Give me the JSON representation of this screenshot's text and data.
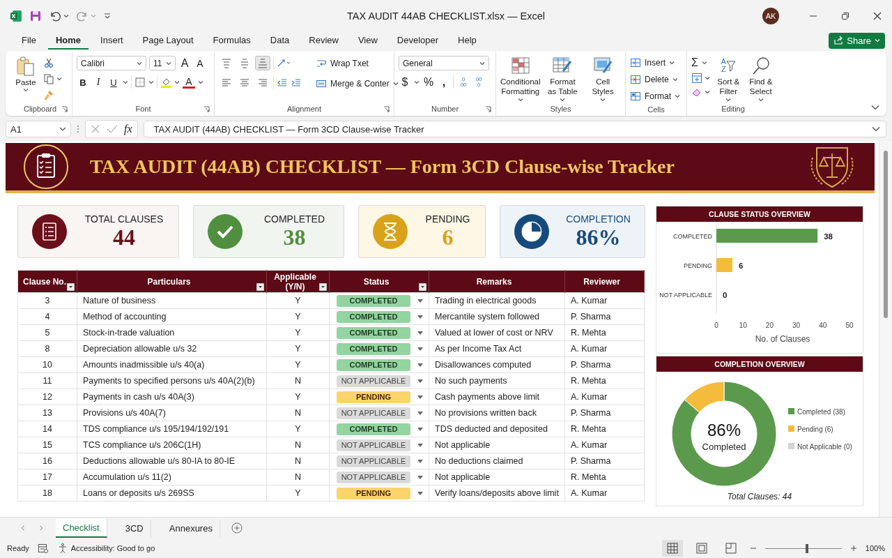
{
  "titlebar": {
    "title": "TAX AUDIT 44AB CHECKLIST.xlsx — Excel",
    "avatar": "AK"
  },
  "menu": [
    {
      "label": "File",
      "selected": false
    },
    {
      "label": "Home",
      "selected": true
    },
    {
      "label": "Insert",
      "selected": false
    },
    {
      "label": "Page Layout",
      "selected": false
    },
    {
      "label": "Formulas",
      "selected": false
    },
    {
      "label": "Data",
      "selected": false
    },
    {
      "label": "Review",
      "selected": false
    },
    {
      "label": "View",
      "selected": false
    },
    {
      "label": "Developer",
      "selected": false
    },
    {
      "label": "Help",
      "selected": false
    }
  ],
  "share": "Share",
  "ribbon": {
    "clipboard": {
      "paste": "Paste",
      "label": "Clipboard"
    },
    "font": {
      "name": "Calibri",
      "size": "11",
      "grow": "A",
      "shrink": "A",
      "bold": "B",
      "italic": "I",
      "underline": "U",
      "font_color_letter": "A",
      "label": "Font"
    },
    "alignment": {
      "vertical": [
        {
          "kind": "top",
          "selected": false
        },
        {
          "kind": "middle",
          "selected": false
        },
        {
          "kind": "bottom",
          "selected": true
        }
      ],
      "horizontal": [
        {
          "kind": "left",
          "selected": false
        },
        {
          "kind": "center",
          "selected": false
        },
        {
          "kind": "right",
          "selected": false
        }
      ],
      "wrap": "Wrap Txet",
      "merge": "Merge & Conter",
      "label": "Alignment"
    },
    "number": {
      "format": "General",
      "currency": "$",
      "percent": "%",
      "comma": ",",
      "decimals": [
        {
          "top": ".0",
          "bottom": ".00"
        },
        {
          "top": ".00",
          "bottom": ".0"
        }
      ],
      "label": "Number"
    },
    "styles": {
      "buttons": [
        {
          "label": "Conditional Formatting",
          "kind": "conditional"
        },
        {
          "label": "Format as Table",
          "kind": "table"
        },
        {
          "label": "Cell Styles",
          "kind": "cell"
        }
      ],
      "label": "Styles"
    },
    "cells": {
      "buttons": [
        {
          "label": "Insert",
          "kind": "insert"
        },
        {
          "label": "Delete",
          "kind": "delete"
        },
        {
          "label": "Format",
          "kind": "format"
        }
      ],
      "label": "Cells"
    },
    "editing": {
      "sum": "Σ",
      "sort_letters": [
        "A",
        "Z"
      ],
      "sort": "Sort & Filter",
      "find": "Find & Select",
      "label": "Editing"
    }
  },
  "formula_bar": {
    "cell": "A1",
    "fx": "fx",
    "formula": "TAX AUDIT (44AB) CHECKLIST — Form 3CD Clause-wise Tracker"
  },
  "banner": {
    "title": "TAX AUDIT (44AB) CHECKLIST — Form 3CD Clause-wise Tracker"
  },
  "kpis": [
    {
      "label": "TOTAL CLAUSES",
      "value": "44",
      "kind": "total"
    },
    {
      "label": "COMPLETED",
      "value": "38",
      "kind": "completed"
    },
    {
      "label": "PENDING",
      "value": "6",
      "kind": "pending"
    },
    {
      "label": "COMPLETION",
      "value": "86%",
      "kind": "completion"
    }
  ],
  "table": {
    "columns": [
      {
        "label": "Clause No.",
        "filter": true
      },
      {
        "label": "Particulars",
        "filter": true
      },
      {
        "label": "Applicable (Y/N)",
        "filter": true
      },
      {
        "label": "Status",
        "filter": true
      },
      {
        "label": "Remarks",
        "filter": false
      },
      {
        "label": "Reviewer",
        "filter": false
      }
    ],
    "rows": [
      {
        "clause": "3",
        "particulars": "Nature of business",
        "applicable": "Y",
        "status": {
          "label": "COMPLETED",
          "kind": "completed"
        },
        "remarks": "Trading in electrical goods",
        "reviewer": "A. Kumar"
      },
      {
        "clause": "4",
        "particulars": "Method of accounting",
        "applicable": "Y",
        "status": {
          "label": "COMPLETED",
          "kind": "completed"
        },
        "remarks": "Mercantile system followed",
        "reviewer": "P. Sharma"
      },
      {
        "clause": "5",
        "particulars": "Stock-in-trade valuation",
        "applicable": "Y",
        "status": {
          "label": "COMPLETED",
          "kind": "completed"
        },
        "remarks": "Valued at lower of cost or NRV",
        "reviewer": "R. Mehta"
      },
      {
        "clause": "8",
        "particulars": "Depreciation allowable u/s 32",
        "applicable": "Y",
        "status": {
          "label": "COMPLETED",
          "kind": "completed"
        },
        "remarks": "As per Income Tax Act",
        "reviewer": "A. Kumar"
      },
      {
        "clause": "10",
        "particulars": "Amounts inadmissible u/s 40(a)",
        "applicable": "Y",
        "status": {
          "label": "COMPLETED",
          "kind": "completed"
        },
        "remarks": "Disallowances computed",
        "reviewer": "P. Sharma"
      },
      {
        "clause": "11",
        "particulars": "Payments to specified persons u/s 40A(2)(b)",
        "applicable": "N",
        "status": {
          "label": "NOT APPLICABLE",
          "kind": "na"
        },
        "remarks": "No such payments",
        "reviewer": "R. Mehta"
      },
      {
        "clause": "12",
        "particulars": "Payments in cash u/s 40A(3)",
        "applicable": "Y",
        "status": {
          "label": "PENDING",
          "kind": "pending"
        },
        "remarks": "Cash payments above limit",
        "reviewer": "A. Kumar"
      },
      {
        "clause": "13",
        "particulars": "Provisions u/s 40A(7)",
        "applicable": "N",
        "status": {
          "label": "NOT APPLICABLE",
          "kind": "na"
        },
        "remarks": "No provisions written back",
        "reviewer": "P. Sharma"
      },
      {
        "clause": "14",
        "particulars": "TDS compliance u/s 195/194/192/191",
        "applicable": "Y",
        "status": {
          "label": "COMPLETED",
          "kind": "completed"
        },
        "remarks": "TDS deducted and deposited",
        "reviewer": "R. Mehta"
      },
      {
        "clause": "15",
        "particulars": "TCS compliance u/s 206C(1H)",
        "applicable": "N",
        "status": {
          "label": "NOT APPLICABLE",
          "kind": "na"
        },
        "remarks": "Not applicable",
        "reviewer": "A. Kumar"
      },
      {
        "clause": "16",
        "particulars": "Deductions allowable u/s 80-IA to 80-IE",
        "applicable": "N",
        "status": {
          "label": "NOT APPLICABLE",
          "kind": "na"
        },
        "remarks": "No deductions claimed",
        "reviewer": "P. Sharma"
      },
      {
        "clause": "17",
        "particulars": "Accumulation u/s 11(2)",
        "applicable": "N",
        "status": {
          "label": "NOT APPLICABLE",
          "kind": "na"
        },
        "remarks": "Not applicable",
        "reviewer": "R. Mehta"
      },
      {
        "clause": "18",
        "particulars": "Loans or deposits u/s 269SS",
        "applicable": "Y",
        "status": {
          "label": "PENDING",
          "kind": "pending"
        },
        "remarks": "Verify loans/deposits above limit",
        "reviewer": "A. Kumar"
      }
    ]
  },
  "bar_panel": {
    "title": "CLAUSE STATUS OVERVIEW",
    "bars": [
      {
        "color": "#5b9a4c"
      },
      {
        "color": "#f4bb3c"
      }
    ],
    "chart_data": {
      "type": "bar",
      "orientation": "horizontal",
      "categories": [
        "COMPLETED",
        "PENDING",
        "NOT APPLICABLE"
      ],
      "values": [
        38,
        6,
        0
      ],
      "xlim": [
        0,
        50
      ],
      "xticks": [
        0,
        10,
        20,
        30,
        40,
        50
      ],
      "xlabel": "No. of Clauses",
      "data_labels": true
    }
  },
  "donut_panel": {
    "title": "COMPLETION OVERVIEW",
    "slices": [
      {
        "color": "#5b9a4c"
      },
      {
        "color": "#f4bb3c"
      },
      {
        "color": "#d4d4d4"
      }
    ],
    "chart_data": {
      "type": "donut",
      "categories": [
        "Completed (38)",
        "Pending (6)",
        "Not Applicable (0)"
      ],
      "values": [
        38,
        6,
        0
      ],
      "legend": "right"
    },
    "center_value": "86%",
    "center_label": "Completed",
    "footer": "Total Clauses: 44"
  },
  "sheet_tabs": [
    {
      "label": "Checklist",
      "selected": true
    },
    {
      "label": "3CD",
      "selected": false
    },
    {
      "label": "Annexures",
      "selected": false
    }
  ],
  "status_bar": {
    "ready": "Ready",
    "accessibility": "Accessibility: Good to go",
    "zoom": "100%",
    "level": 0.55
  }
}
